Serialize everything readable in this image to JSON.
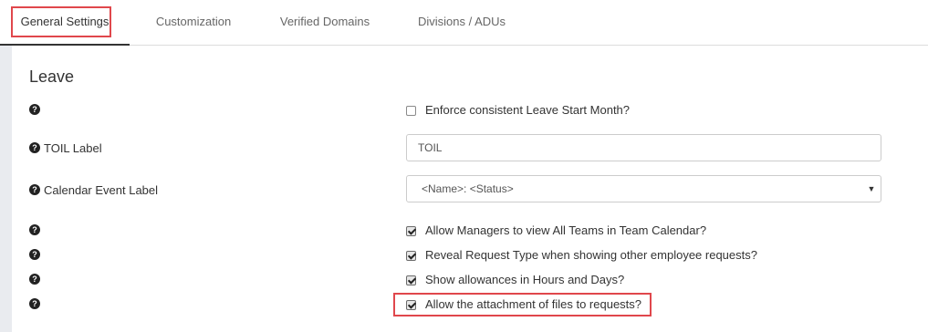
{
  "tabs": [
    {
      "label": "General Settings"
    },
    {
      "label": "Customization"
    },
    {
      "label": "Verified Domains"
    },
    {
      "label": "Divisions / ADUs"
    }
  ],
  "section": {
    "title": "Leave"
  },
  "icons": {
    "help": "question-circle-icon",
    "help_glyph": "?"
  },
  "rows": {
    "enforce_start_month": {
      "label": "Enforce consistent Leave Start Month?",
      "checked": false
    },
    "toil_label": {
      "label": "TOIL Label",
      "value": "TOIL"
    },
    "calendar_event_label": {
      "label": "Calendar Event Label",
      "selected": "<Name>: <Status>",
      "caret": "▼"
    },
    "managers_view_all_teams": {
      "label": "Allow Managers to view All Teams in Team Calendar?",
      "checked": true
    },
    "reveal_request_type": {
      "label": "Reveal Request Type when showing other employee requests?",
      "checked": true
    },
    "show_allowances": {
      "label": "Show allowances in Hours and Days?",
      "checked": true
    },
    "allow_attachments": {
      "label": "Allow the attachment of files to requests?",
      "checked": true
    }
  },
  "colors": {
    "highlight": "#e0474c",
    "left_strip": "#e9ebef",
    "active_tab_underline": "#333333"
  }
}
